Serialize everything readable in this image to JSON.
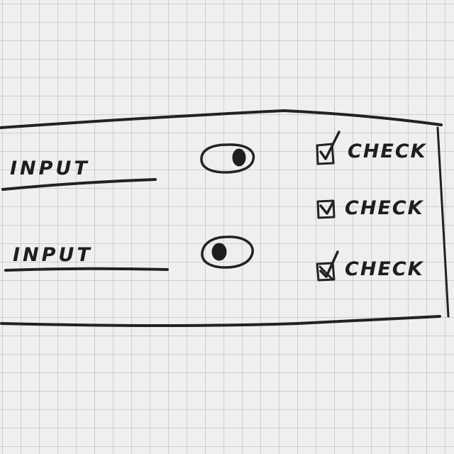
{
  "form": {
    "inputs": [
      {
        "label": "INPUT"
      },
      {
        "label": "INPUT"
      }
    ],
    "toggles": [
      {
        "icon": "toggle-icon",
        "state": "on"
      },
      {
        "icon": "toggle-icon",
        "state": "off"
      }
    ],
    "checkboxes": [
      {
        "label": "CHECK",
        "checked": true
      },
      {
        "label": "CHECK",
        "checked": true
      },
      {
        "label": "CHECK",
        "checked": true
      }
    ]
  }
}
